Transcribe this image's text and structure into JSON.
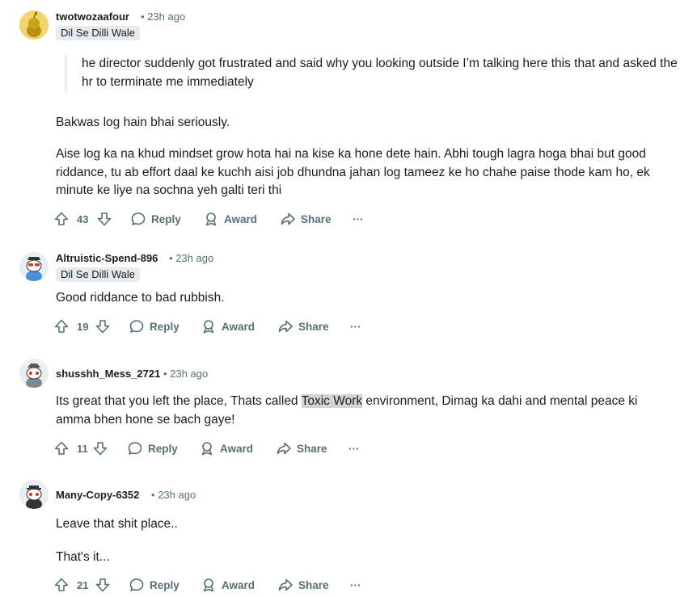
{
  "comments": [
    {
      "author": "twotwozaafour",
      "time": "23h ago",
      "flair": "Dil Se Dilli Wale",
      "quote": "he director suddenly got frustrated and said why you looking outside I’m talking here this that and asked the hr to terminate me immediately",
      "paragraphs": [
        "Bakwas log hain bhai seriously.",
        "Aise log ka na khud mindset grow hota hai na kise ka hone dete hain. Abhi tough lagra hoga bhai but good riddance, tu ab effort daal ke kuchh aisi job dhundna jahan log tameez ke ho chahe paise thode kam ho, ek minute ke liye na sochna yeh galti teri thi"
      ],
      "votes": "43"
    },
    {
      "author": "Altruistic-Spend-896",
      "time": "23h ago",
      "flair": "Dil Se Dilli Wale",
      "paragraphs": [
        "Good riddance to bad rubbish."
      ],
      "votes": "19"
    },
    {
      "author": "shusshh_Mess_2721",
      "time": "23h ago",
      "text_before": "Its great that you left the place, Thats called ",
      "text_highlight": "Toxic Work",
      "text_after": " environment, Dimag ka dahi and mental peace ki amma bhen hone se bach gaye!",
      "votes": "11"
    },
    {
      "author": "Many-Copy-6352",
      "time": "23h ago",
      "paragraphs": [
        "Leave that shit place..",
        "That's it..."
      ],
      "votes": "21"
    }
  ],
  "actions": {
    "reply": "Reply",
    "award": "Award",
    "share": "Share",
    "more": "···"
  },
  "colors": {
    "meta": "#576f76",
    "flair_bg": "#e5ebee",
    "highlight": "#d4d4d4"
  }
}
